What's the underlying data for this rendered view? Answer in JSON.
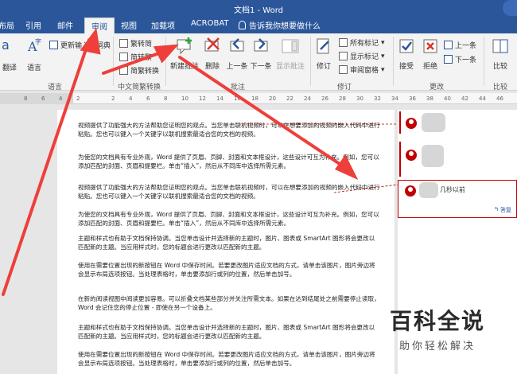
{
  "window": {
    "title": "文档1 - Word"
  },
  "tabs": [
    {
      "label": "布局"
    },
    {
      "label": "引用"
    },
    {
      "label": "邮件"
    },
    {
      "label": "审阅"
    },
    {
      "label": "视图"
    },
    {
      "label": "加载项"
    },
    {
      "label": "ACROBAT"
    }
  ],
  "tellme": {
    "label": "告诉我你想要做什么"
  },
  "ribbon": {
    "translate": "翻译",
    "language": "语言",
    "update_ime": "更新输入法词典",
    "group_language": "语言",
    "to_traditional": "繁转简",
    "to_simplified": "简转繁",
    "simp_trad": "简繁转换",
    "group_chinese": "中文简繁转换",
    "new_comment": "新建批注",
    "delete": "删除",
    "previous": "上一条",
    "next": "下一条",
    "show_comments": "显示批注",
    "group_comments": "批注",
    "track": "修订",
    "all_markup": "所有标记",
    "show_markup": "显示标记",
    "review_pane": "审阅窗格",
    "group_tracking": "修订",
    "accept": "接受",
    "reject": "拒绝",
    "prev_change": "上一条",
    "next_change": "下一条",
    "group_changes": "更改",
    "compare": "比较",
    "group_compare": "比较"
  },
  "ruler": {
    "ticks": [
      "8",
      "6",
      "4",
      "2",
      "",
      "2",
      "4",
      "6",
      "8",
      "10",
      "12",
      "14",
      "16",
      "18",
      "20",
      "22",
      "24",
      "26",
      "28",
      "30",
      "32",
      "34",
      "36",
      "38",
      "40",
      "42",
      "44",
      "46"
    ]
  },
  "document": {
    "paragraphs": [
      "视频提供了功能强大的方法帮助您证明您的观点。当您单击联机视频时，可以在想要添加的视频的嵌入代码中进行粘贴。您也可以键入一个关键字以联机搜索最适合您的文档的视频。",
      "为使您的文档具有专业外观，Word 提供了页眉、页脚、封面和文本框设计，这些设计可互为补充。例如，您可以添加匹配的封面、页眉和提要栏。单击“插入”，然后从不同库中选择所需元素。",
      "视频提供了功能强大的方法帮助您证明您的观点。当您单击联机视频时，可以在想要添加的视频的嵌入代码中进行粘贴。您也可以键入一个关键字以联机搜索最适合您的文档的视频。",
      "为使您的文档具有专业外观，Word 提供了页眉、页脚、封面和文本框设计，这些设计可互为补充。例如，您可以添加匹配的封面、页眉和提要栏。单击“插入”，然后从不同库中选择所需元素。",
      "主题和样式也有助于文档保持协调。当您单击设计并选择新的主题时，图片、图表或 SmartArt 图形将会更改以匹配新的主题。当应用样式时，您的标题会进行更改以匹配新的主题。",
      "使用在需要位置出现的新按钮在 Word 中保存时间。若要更改图片适应文档的方式，请单击该图片，图片旁边将会显示布局选项按钮。当处理表格时，单击要添加行或列的位置，然后单击加号。",
      "在新的阅读视图中阅读更加容易。可以折叠文档某些部分并关注所需文本。如果在达到结尾处之前需要停止读取，Word 会记住您的停止位置 - 即使在另一个设备上。",
      "主题和样式也有助于文档保持协调。当您单击设计并选择新的主题时，图片、图表或 SmartArt 图形将会更改以匹配新的主题。当应用样式时，您的标题会进行更改以匹配新的主题。",
      "使用在需要位置出现的新按钮在 Word 中保存时间。若要更改图片适应文档的方式，请单击该图片，图片旁边将会显示布局选项按钮。当处理表格时，单击要添加行或列的位置，然后单击加号。"
    ]
  },
  "comments": {
    "time_label": "几秒以前",
    "reply_label": "答复"
  },
  "watermark": {
    "line1": "百科全说",
    "line2": "助你轻松解决"
  },
  "colors": {
    "brand": "#2b579a",
    "arrow": "#ee3f3a",
    "comment": "#c00000"
  }
}
